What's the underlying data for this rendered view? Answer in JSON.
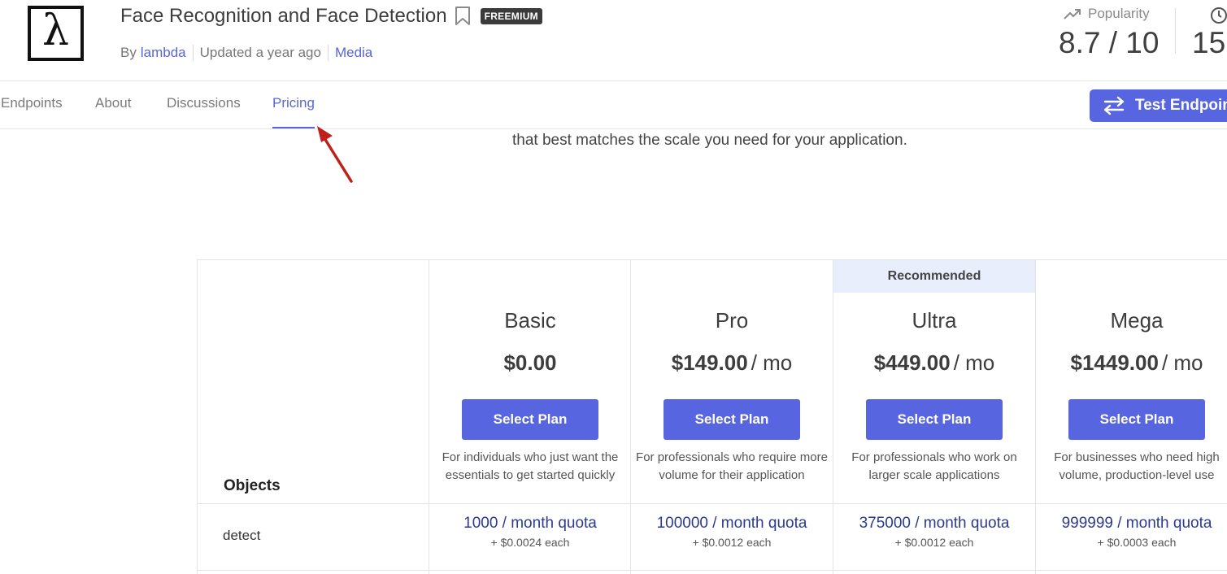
{
  "header": {
    "logo_glyph": "λ",
    "title": "Face Recognition and Face Detection",
    "badge": "FREEMIUM",
    "by_prefix": "By",
    "author": "lambda",
    "updated": "Updated a year ago",
    "category": "Media"
  },
  "stats": {
    "popularity_label": "Popularity",
    "popularity_value": "8.7 / 10",
    "latency_value": "15"
  },
  "tabs": [
    {
      "label": "Endpoints"
    },
    {
      "label": "About"
    },
    {
      "label": "Discussions"
    },
    {
      "label": "Pricing",
      "active": true
    }
  ],
  "test_button": "Test Endpoint",
  "intro_text": "that best matches the scale you need for your application.",
  "pricing": {
    "recommended_label": "Recommended",
    "objects_label": "Objects",
    "select_label": "Select Plan",
    "plans": [
      {
        "name": "Basic",
        "price": "$0.00",
        "period": "",
        "description": "For individuals who just want the essentials to get started quickly"
      },
      {
        "name": "Pro",
        "price": "$149.00",
        "period": "/ mo",
        "description": "For professionals who require more volume for their application"
      },
      {
        "name": "Ultra",
        "price": "$449.00",
        "period": "/ mo",
        "description": "For professionals who work on larger scale applications"
      },
      {
        "name": "Mega",
        "price": "$1449.00",
        "period": "/ mo",
        "description": "For businesses who need high volume, production-level use"
      }
    ],
    "rows": [
      {
        "label": "detect",
        "cells": [
          {
            "quota": "1000 / month quota",
            "overage": "+ $0.0024 each"
          },
          {
            "quota": "100000 / month quota",
            "overage": "+ $0.0012 each"
          },
          {
            "quota": "375000 / month quota",
            "overage": "+ $0.0012 each"
          },
          {
            "quota": "999999 / month quota",
            "overage": "+ $0.0003 each"
          }
        ]
      }
    ]
  },
  "colors": {
    "accent": "#5865e0",
    "link": "#5865d6",
    "recommended_bg": "#e8eefc",
    "annotation_arrow": "#c0201c"
  },
  "icons": [
    "lambda-logo",
    "bookmark-icon",
    "trending-up-icon",
    "clock-icon",
    "swap-arrows-icon",
    "annotation-arrow"
  ]
}
